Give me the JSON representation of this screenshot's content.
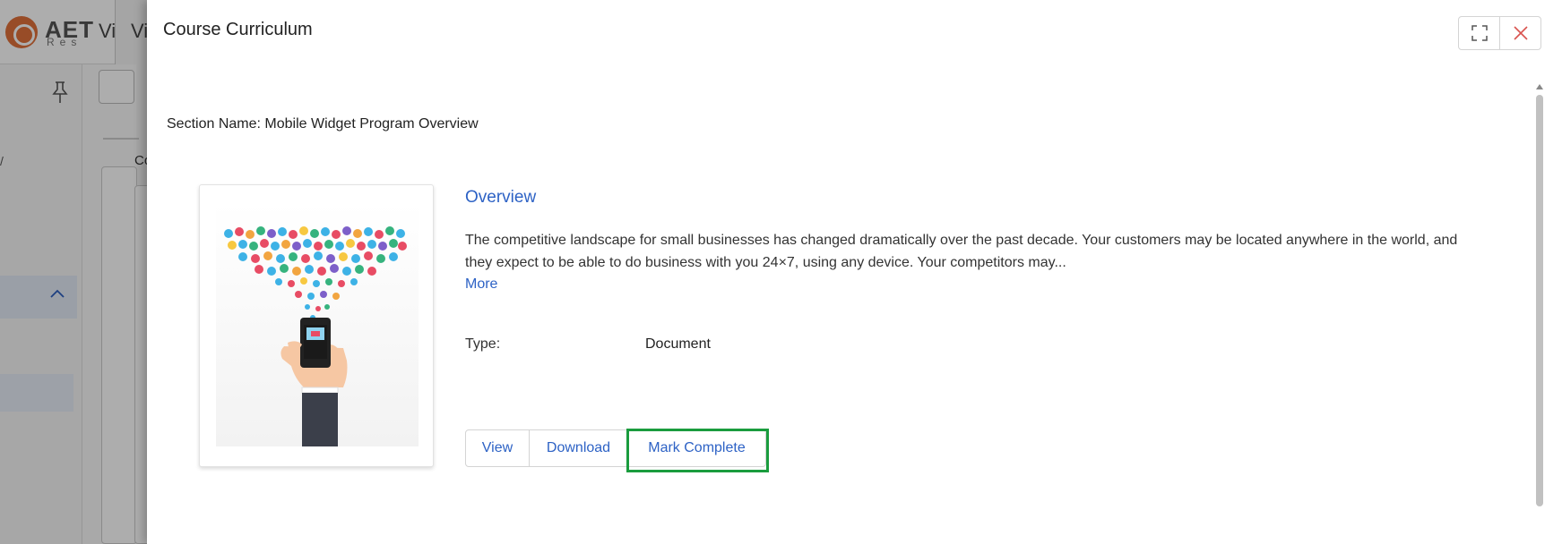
{
  "background": {
    "logo_text": "AET",
    "logo_sub": "Res",
    "title_fragment_1": "Vi",
    "title_fragment_2": "Vi",
    "side_mark": "/",
    "content_fragment": "Co"
  },
  "modal": {
    "title": "Course Curriculum",
    "section_label": "Section Name: Mobile Widget Program Overview",
    "item": {
      "title": "Overview",
      "description": "The competitive landscape for small businesses has changed dramatically over the past decade. Your customers may be located anywhere in the world, and they expect to be able to do business with you 24×7, using any device. Your competitors may...",
      "more_label": "More",
      "type_label": "Type:",
      "type_value": "Document"
    },
    "actions": {
      "view_label": "View",
      "download_label": "Download",
      "mark_complete_label": "Mark Complete"
    },
    "icons": {
      "expand": "expand-icon",
      "close": "close-icon"
    }
  },
  "colors": {
    "accent": "#2d62c5",
    "highlight": "#1a9c3e",
    "close": "#d9534f",
    "logo": "#e0703a"
  }
}
